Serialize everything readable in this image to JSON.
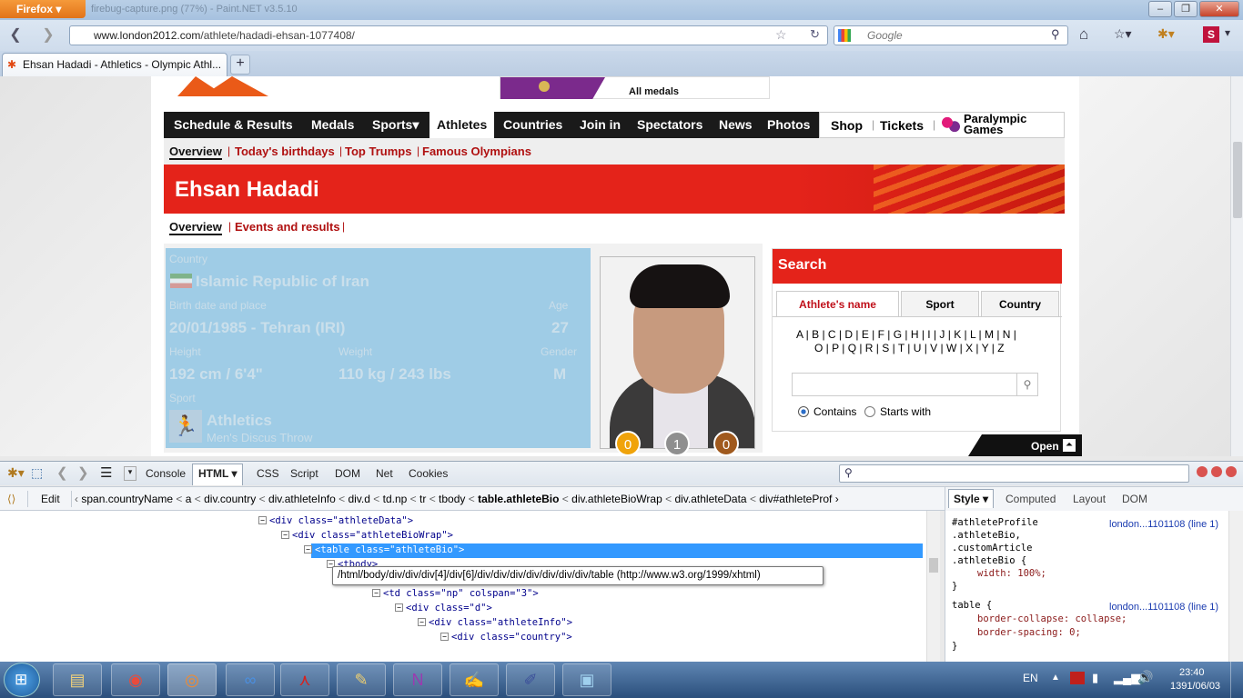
{
  "browser": {
    "app_button": "Firefox",
    "window_title": "firebug-capture.png (77%) - Paint.NET v3.5.10",
    "url_host": "www.london2012.com",
    "url_path": "/athlete/hadadi-ehsan-1077408/",
    "search_placeholder": "Google",
    "tab_title": "Ehsan Hadadi - Athletics - Olympic Athl..."
  },
  "site": {
    "all_medals": "All medals",
    "nav": [
      "Schedule & Results",
      "Medals",
      "Sports",
      "Athletes",
      "Countries",
      "Join in",
      "Spectators",
      "News",
      "Photos"
    ],
    "shop": "Shop",
    "tickets": "Tickets",
    "paralympic": "Paralympic Games",
    "subnav": [
      "Overview",
      "Today's birthdays",
      "Top Trumps",
      "Famous Olympians"
    ],
    "athlete_name": "Ehsan Hadadi",
    "athlete_tabs": [
      "Overview",
      "Events and results"
    ],
    "bio": {
      "country_label": "Country",
      "country": "Islamic Republic of Iran",
      "birth_label": "Birth date and place",
      "birth": "20/01/1985 - Tehran (IRI)",
      "age_label": "Age",
      "age": "27",
      "height_label": "Height",
      "height": "192 cm / 6'4\"",
      "weight_label": "Weight",
      "weight": "110 kg / 243 lbs",
      "gender_label": "Gender",
      "gender": "M",
      "sport_label": "Sport",
      "sport": "Athletics",
      "event": "Men's Discus Throw"
    },
    "medals": {
      "gold": "0",
      "silver": "1",
      "bronze": "0"
    },
    "search": {
      "title": "Search",
      "tabs": [
        "Athlete's name",
        "Sport",
        "Country"
      ],
      "letters1": "A | B | C | D | E | F | G | H | I | J | K | L | M | N |",
      "letters2": "O | P | Q | R | S | T | U | V | W | X | Y | Z",
      "contains": "Contains",
      "starts": "Starts with",
      "open": "Open"
    }
  },
  "firebug": {
    "tabs": [
      "Console",
      "HTML",
      "CSS",
      "Script",
      "DOM",
      "Net",
      "Cookies"
    ],
    "edit": "Edit",
    "breadcrumb": [
      "span.countryName",
      "a",
      "div.country",
      "div.athleteInfo",
      "div.d",
      "td.np",
      "tr",
      "tbody",
      "table.athleteBio",
      "div.athleteBioWrap",
      "div.athleteData",
      "div#athleteProf"
    ],
    "side_tabs": [
      "Style",
      "Computed",
      "Layout",
      "DOM"
    ],
    "tooltip": "/html/body/div/div/div[4]/div[6]/div/div/div/div/div/div/div/table (http://www.w3.org/1999/xhtml)",
    "html_lines": [
      {
        "t": "<div class=\"athleteData\">"
      },
      {
        "t": "<div class=\"athleteBioWrap\">"
      },
      {
        "t": "<table class=\"athleteBio\">"
      },
      {
        "t": "<tbody>"
      },
      {
        "t": "<tr>"
      },
      {
        "t": "<td class=\"np\" colspan=\"3\">"
      },
      {
        "t": "<div class=\"d\">"
      },
      {
        "t": "<div class=\"athleteInfo\">"
      },
      {
        "t": "<div class=\"country\">"
      }
    ],
    "style_src": "london...1101108 (line 1)",
    "style_lines": [
      "#athleteProfile",
      ".athleteBio,",
      ".customArticle",
      ".athleteBio {",
      "width: 100%;",
      "}",
      "table {",
      "border-collapse: collapse;",
      "border-spacing: 0;",
      "}"
    ]
  },
  "taskbar": {
    "lang": "EN",
    "time": "23:40",
    "date": "1391/06/03"
  }
}
